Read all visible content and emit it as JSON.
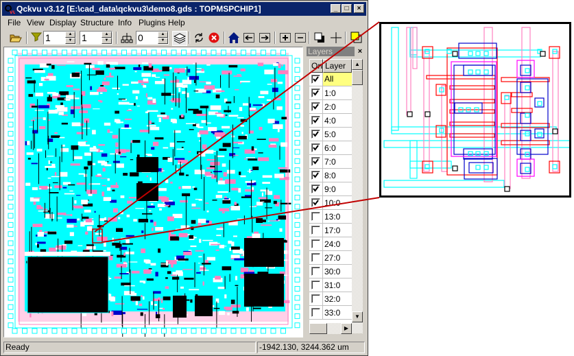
{
  "window": {
    "title": "Qckvu v3.12 [E:\\cad_data\\qckvu3\\demo8.gds : TOPMSPCHIP1]",
    "controls": {
      "minimize": "_",
      "maximize": "□",
      "close": "×"
    }
  },
  "menubar": {
    "items": [
      {
        "label": "File"
      },
      {
        "label": "View"
      },
      {
        "label": "Display"
      },
      {
        "label": "Structure"
      },
      {
        "label": "Info"
      },
      {
        "label": "Plugins"
      },
      {
        "label": "Help"
      }
    ]
  },
  "toolbar": {
    "open_icon": "folder-open-icon",
    "filter_icon": "filter-funnel-icon",
    "spin1_value": "1",
    "spin2_value": "1",
    "hierarchy_icon": "hierarchy-tree-icon",
    "spin3_value": "0",
    "layers_icon": "layers-stack-icon",
    "refresh_icon": "refresh-icon",
    "stop_icon": "stop-icon",
    "home_icon": "home-icon",
    "back_icon": "arrow-left-icon",
    "forward_icon": "arrow-right-icon",
    "zoom_in_icon": "plus-icon",
    "zoom_out_icon": "minus-icon",
    "fill_icon": "fill-toggle-icon",
    "crosshair_icon": "crosshair-icon",
    "color_icon": "color-select-icon"
  },
  "layers_panel": {
    "title": "Layers",
    "close": "×",
    "columns": [
      "On",
      "Layer"
    ],
    "rows": [
      {
        "name": "All",
        "on": true,
        "selected": true
      },
      {
        "name": "1:0",
        "on": true
      },
      {
        "name": "2:0",
        "on": true
      },
      {
        "name": "4:0",
        "on": true
      },
      {
        "name": "5:0",
        "on": true
      },
      {
        "name": "6:0",
        "on": true
      },
      {
        "name": "7:0",
        "on": true
      },
      {
        "name": "8:0",
        "on": true
      },
      {
        "name": "9:0",
        "on": true
      },
      {
        "name": "10:0",
        "on": true
      },
      {
        "name": "13:0",
        "on": false
      },
      {
        "name": "17:0",
        "on": false
      },
      {
        "name": "24:0",
        "on": false
      },
      {
        "name": "27:0",
        "on": false
      },
      {
        "name": "30:0",
        "on": false
      },
      {
        "name": "31:0",
        "on": false
      },
      {
        "name": "32:0",
        "on": false
      },
      {
        "name": "33:0",
        "on": false
      }
    ]
  },
  "statusbar": {
    "status": "Ready",
    "coordinates": "-1942.130, 3244.362 um"
  },
  "colors": {
    "layer_cyan": "#00ffff",
    "layer_pink": "#ff80c0",
    "layer_red": "#ff0000",
    "layer_blue": "#0000cc",
    "layer_magenta": "#ff00ff",
    "callout_line": "#c00000",
    "title_bar": "#0a246a",
    "selected_row": "#ffff80"
  }
}
